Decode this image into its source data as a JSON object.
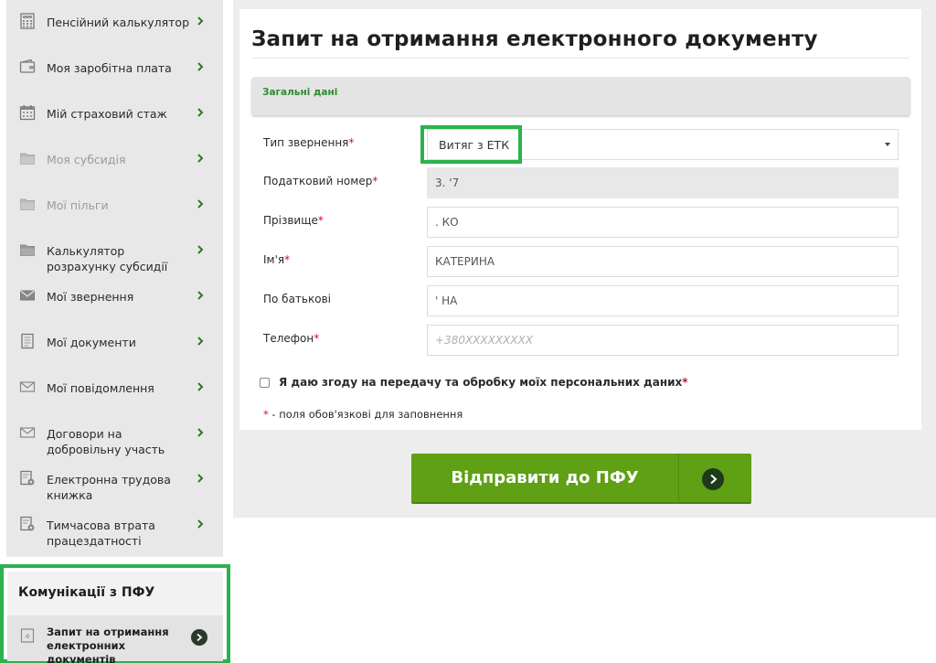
{
  "sidebar": {
    "items": [
      {
        "label": "Пенсійний калькулятор",
        "icon": "calculator-icon"
      },
      {
        "label": "Моя заробітна плата",
        "icon": "wallet-icon"
      },
      {
        "label": "Мій страховий стаж",
        "icon": "calendar-icon"
      },
      {
        "label": "Моя субсидія",
        "icon": "folder-icon"
      },
      {
        "label": "Мої пільги",
        "icon": "folder-icon"
      },
      {
        "label": "Калькулятор розрахунку субсидії",
        "icon": "folder-icon"
      },
      {
        "label": "Мої звернення",
        "icon": "envelope-icon"
      },
      {
        "label": "Мої документи",
        "icon": "document-icon"
      },
      {
        "label": "Мої повідомлення",
        "icon": "envelope-icon"
      },
      {
        "label": "Договори на добровільну участь",
        "icon": "envelope-icon"
      },
      {
        "label": "Електронна трудова книжка",
        "icon": "workbook-icon"
      },
      {
        "label": "Тимчасова втрата працездатності",
        "icon": "workbook-icon"
      }
    ],
    "communications": {
      "title": "Комунікації з ПФУ",
      "sub_item": "Запит на отримання електронних документів"
    }
  },
  "main": {
    "title": "Запит на отримання електронного документу",
    "section": "Загальні дані",
    "form": {
      "request_type": {
        "label": "Тип звернення",
        "value": "Витяг з ЕТК"
      },
      "tax_number": {
        "label": "Податковий номер",
        "value": "3.       '7"
      },
      "surname": {
        "label": "Прізвище",
        "value": ".      КО"
      },
      "name": {
        "label": "Ім'я",
        "value": "КАТЕРИНА"
      },
      "patronymic": {
        "label": "По батькові",
        "value": "'        НА"
      },
      "phone": {
        "label": "Телефон",
        "placeholder": "+380XXXXXXXXX"
      },
      "required_mark": "*"
    },
    "consent": "Я даю згоду на передачу та обробку моїх персональних даних",
    "required_note": "- поля обов'язкові для заповнення",
    "submit_label": "Відправити до ПФУ"
  },
  "colors": {
    "accent_green": "#5fa015",
    "highlight_green": "#2bb24c",
    "section_text": "#2e8b2e",
    "required": "#c8102e",
    "sidebar_bg": "#e8e8e8"
  }
}
